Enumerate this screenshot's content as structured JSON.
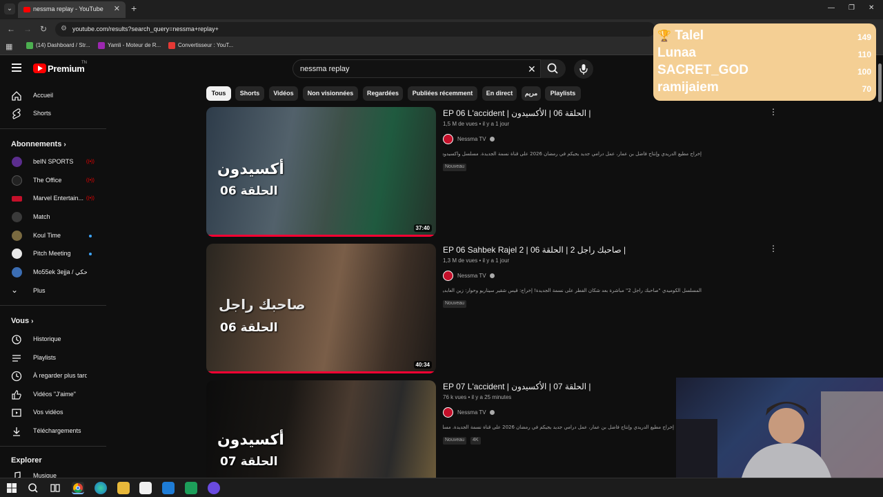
{
  "browser": {
    "tab_title": "nessma replay - YouTube",
    "url": "youtube.com/results?search_query=nessma+replay+",
    "bookmarks": [
      "(14) Dashboard / Str...",
      "Yamli - Moteur de R...",
      "Convertisseur : YouT..."
    ]
  },
  "youtube": {
    "logo_text": "Premium",
    "logo_sup": "TN",
    "search_value": "nessma replay"
  },
  "sidebar": {
    "main": [
      {
        "label": "Accueil",
        "icon": "home-icon"
      },
      {
        "label": "Shorts",
        "icon": "shorts-icon"
      }
    ],
    "subscriptions_heading": "Abonnements",
    "subscriptions": [
      {
        "label": "beIN SPORTS",
        "indicator": "live",
        "color": "#5b2d8e"
      },
      {
        "label": "The Office",
        "indicator": "live",
        "color": "#222222"
      },
      {
        "label": "Marvel Entertain...",
        "indicator": "live",
        "color": "#c4102a"
      },
      {
        "label": "Match",
        "indicator": "none",
        "color": "#3a3a3a"
      },
      {
        "label": "Koul Time",
        "indicator": "new",
        "color": "#7a6a40"
      },
      {
        "label": "Pitch Meeting",
        "indicator": "new",
        "color": "#e8e8e8"
      },
      {
        "label": "Mo55ek 3ejja / حكي",
        "indicator": "none",
        "color": "#3b6db3"
      }
    ],
    "more_label": "Plus",
    "you_heading": "Vous",
    "you": [
      {
        "label": "Historique",
        "icon": "history-icon"
      },
      {
        "label": "Playlists",
        "icon": "playlists-icon"
      },
      {
        "label": "À regarder plus tard",
        "icon": "watch-later-icon"
      },
      {
        "label": "Vidéos \"J'aime\"",
        "icon": "like-icon"
      },
      {
        "label": "Vos vidéos",
        "icon": "your-videos-icon"
      },
      {
        "label": "Téléchargements",
        "icon": "downloads-icon"
      }
    ],
    "explore_heading": "Explorer",
    "explore": [
      {
        "label": "Musique",
        "icon": "music-icon"
      }
    ]
  },
  "chips": [
    "Tous",
    "Shorts",
    "Vidéos",
    "Non visionnées",
    "Regardées",
    "Publiées récemment",
    "En direct",
    "مريم",
    "Playlists"
  ],
  "results": [
    {
      "title": "EP 06 L'accident | الحلقة 06 | الأكسيدون |",
      "views": "1,5 M de vues",
      "age": "il y a 1 jour",
      "channel": "Nessma TV",
      "description": "إخراج مطيع الدريدي وإنتاج فاضل بن عمار، عمل درامي جديد يجيكم في رمضان 2026 على قناة نسمة الجديدة. مسلسل واكسيدون يحكم بقصة ...",
      "badges": [
        "Nouveau"
      ],
      "duration": "37:40",
      "thumb_text_1": "أكسيدون",
      "thumb_text_2": "الحلقة 06"
    },
    {
      "title": "EP 06 Sahbek Rajel 2 | صاحبك راجل 2 | الحلقة 06 |",
      "views": "1,3 M de vues",
      "age": "il y a 1 jour",
      "channel": "Nessma TV",
      "description": "المسلسل الكوميدي \"صاحبك راجل 2\" مباشرة بعد شكان الفطر على نسمة الجديدة! إخراج: قيس شقير سيناريو وحوار: زين العابدين الصفوري ...",
      "badges": [
        "Nouveau"
      ],
      "duration": "40:34",
      "thumb_text_1": "صاحبك راجل",
      "thumb_text_2": "الحلقة 06"
    },
    {
      "title": "EP 07 L'accident | الحلقة 07 | الأكسيدون |",
      "views": "76 k vues",
      "age": "il y a 25 minutes",
      "channel": "Nessma TV",
      "description": "إخراج مطيع الدريدي وإنتاج فاضل بن عمار، عمل درامي جديد يجيكم في رمضان 2026 على قناة نسمة الجديدة. مسلسل واكسيدون يحكم بقصة",
      "badges": [
        "Nouveau",
        "4K"
      ],
      "duration": "",
      "thumb_text_1": "أكسيدون",
      "thumb_text_2": "الحلقة 07"
    }
  ],
  "leaderboard": [
    {
      "name": "Talel",
      "score": "149",
      "icon": "trophy-icon"
    },
    {
      "name": "Lunaa",
      "score": "110"
    },
    {
      "name": "SACRET_GOD",
      "score": "100"
    },
    {
      "name": "ramijaiem",
      "score": "70"
    }
  ],
  "colors": {
    "background": "#0f0f0f",
    "youtube_red": "#ff0000",
    "leaderboard_bg": "#f4cf94",
    "progress": "#ff0033"
  }
}
